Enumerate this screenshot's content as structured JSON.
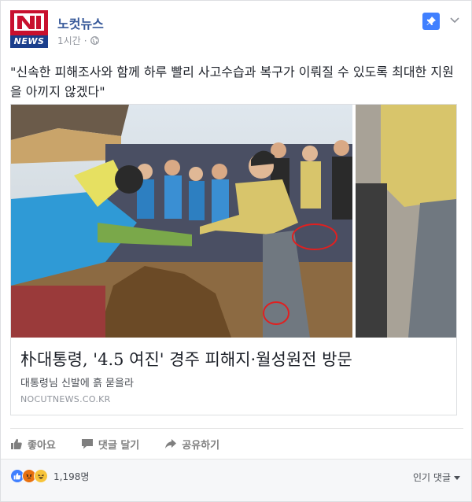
{
  "page": {
    "name": "노컷뉴스",
    "logo_text": "NEWS",
    "logo_letter": "N",
    "time": "1시간"
  },
  "post": {
    "text": "\"신속한 피해조사와 함께 하루 빨리 사고수습과 복구가 이뤄질 수 있도록 최대한 지원을 아끼지 않겠다\""
  },
  "link": {
    "title": "朴대통령, '4.5 여진' 경주 피해지·월성원전 방문",
    "description": "대통령님 신발에 흙 묻을라",
    "domain": "NOCUTNEWS.CO.KR"
  },
  "actions": {
    "like": "좋아요",
    "comment": "댓글 달기",
    "share": "공유하기"
  },
  "footer": {
    "reaction_count": "1,198명",
    "sort_label": "인기 댓글"
  },
  "colors": {
    "brand_red": "#c8102e",
    "brand_blue": "#1a3e8c",
    "link_blue": "#365899",
    "like_blue": "#4080ff"
  }
}
